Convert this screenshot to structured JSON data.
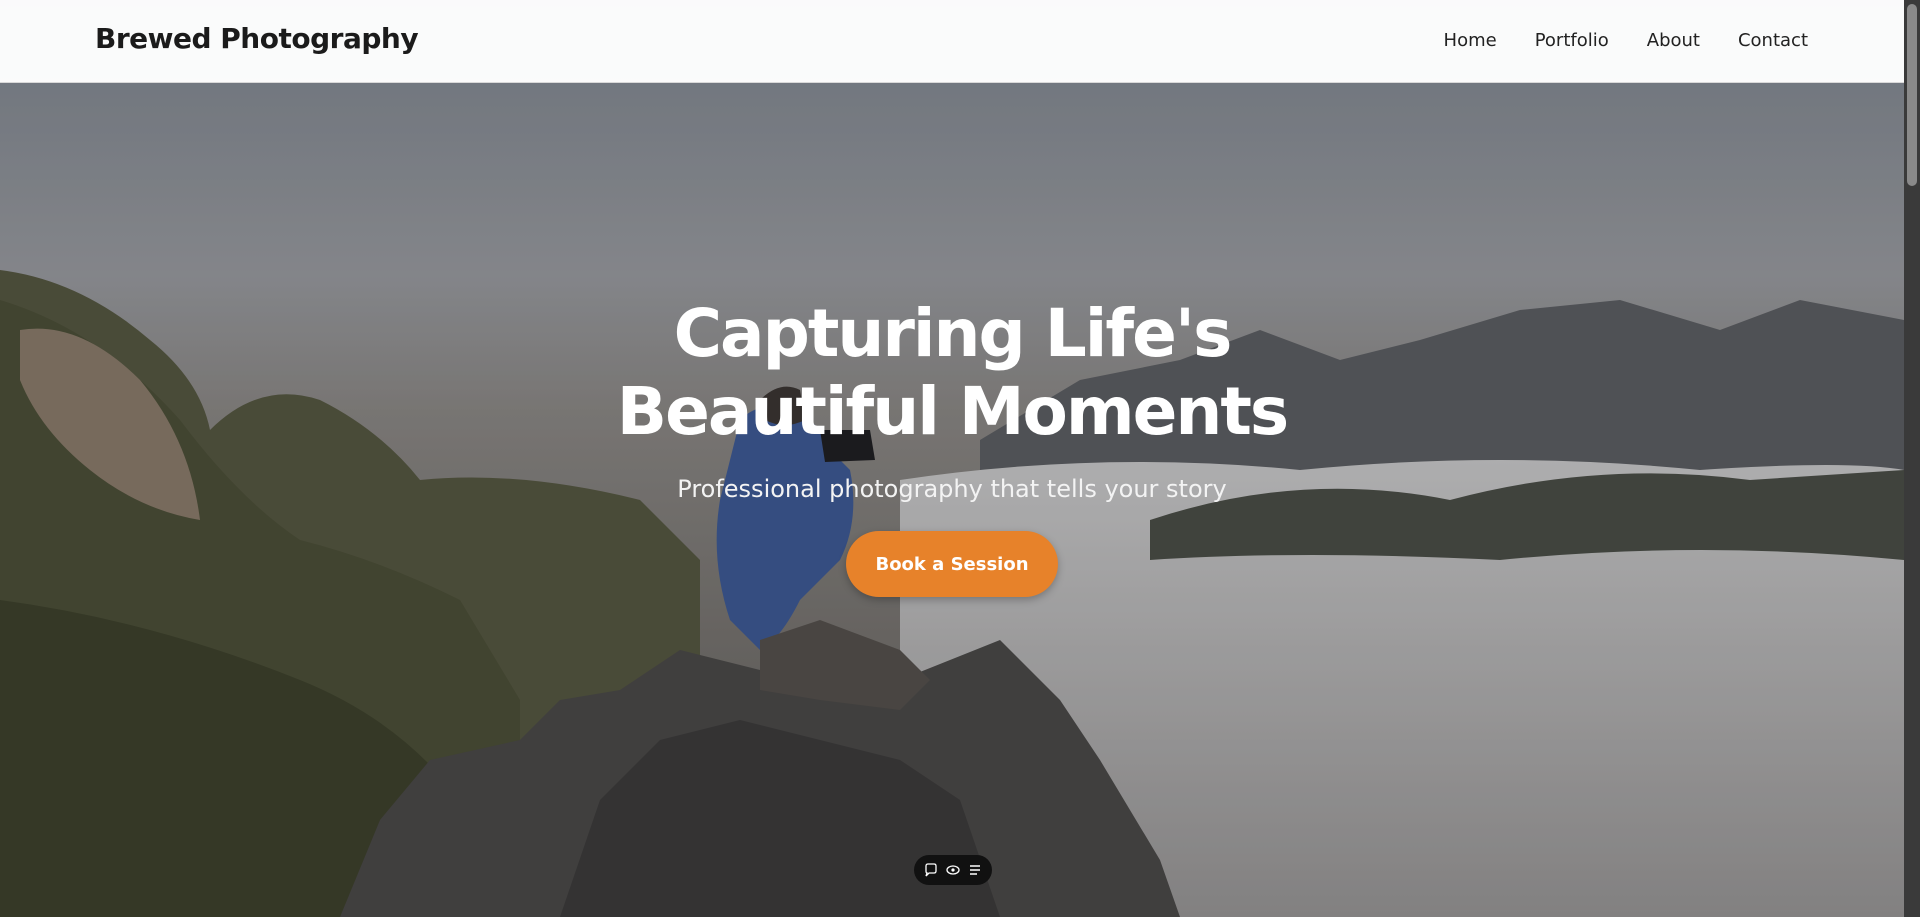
{
  "navbar": {
    "brand": "Brewed Photography",
    "links": [
      {
        "label": "Home"
      },
      {
        "label": "Portfolio"
      },
      {
        "label": "About"
      },
      {
        "label": "Contact"
      }
    ]
  },
  "hero": {
    "title_line1": "Capturing Life's",
    "title_line2": "Beautiful Moments",
    "subtitle": "Professional photography that tells your story",
    "cta_label": "Book a Session",
    "image_alt": "Photographer on a mountain peak above clouds"
  },
  "floating_toolbar": {
    "icons": [
      "chat-icon",
      "eye-icon",
      "menu-icon"
    ]
  },
  "colors": {
    "accent": "#e7822a",
    "nav_text": "#222222",
    "brand_text": "#1b1b1b",
    "hero_text": "#ffffff"
  }
}
